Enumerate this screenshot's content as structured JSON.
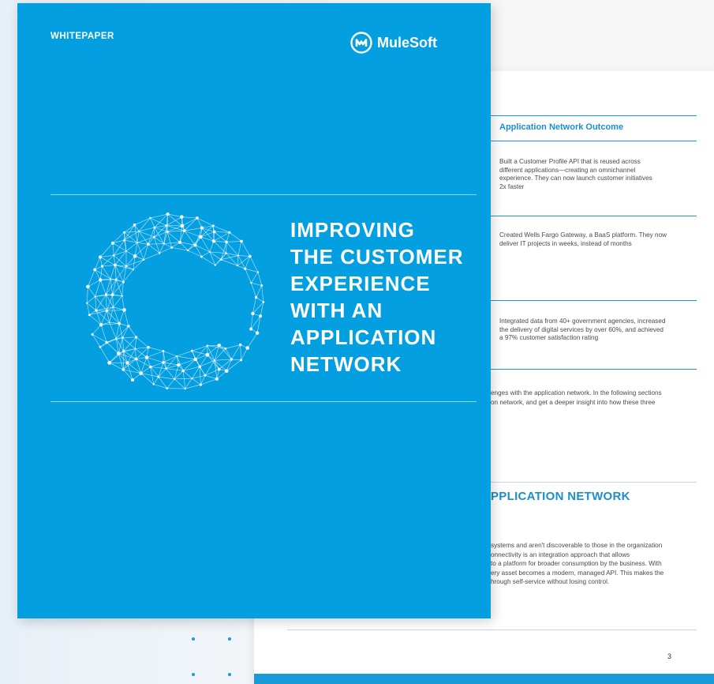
{
  "cover": {
    "label": "WHITEPAPER",
    "brand": "MuleSoft",
    "title_lines": [
      "IMPROVING",
      "THE CUSTOMER",
      "EXPERIENCE",
      "WITH AN",
      "APPLICATION",
      "NETWORK"
    ],
    "background_color": "#039fe0",
    "globe_icon": "wireframe-globe-icon"
  },
  "back_page": {
    "table_heading": "Application Network Outcome",
    "outcomes": [
      [
        "Built a Customer Profile API that is reused across",
        "different applications—creating an omnichannel",
        "experience. They can now launch customer initiatives",
        "2x faster"
      ],
      [
        "Created Wells Fargo Gateway, a BaaS platform. They now",
        "deliver IT projects in weeks, instead of months"
      ],
      [
        "Integrated data from 40+ government agencies, increased",
        "the delivery of digital services by over 60%, and achieved",
        "a 97% customer satisfaction rating"
      ]
    ],
    "paragraph_1": [
      "enges with the application network. In the following sections",
      "on network, and get a deeper insight into how these three"
    ],
    "section_heading": "PPLICATION NETWORK",
    "paragraph_2": [
      "systems and aren't discoverable to those in the organization",
      "onnectivity is an integration approach that allows",
      "to a platform for broader consumption by the business. With",
      "ery asset becomes a modern, managed API. This makes the",
      "hrough self-service without losing control."
    ],
    "page_number": "3",
    "accent_color": "#1b8fcb"
  }
}
